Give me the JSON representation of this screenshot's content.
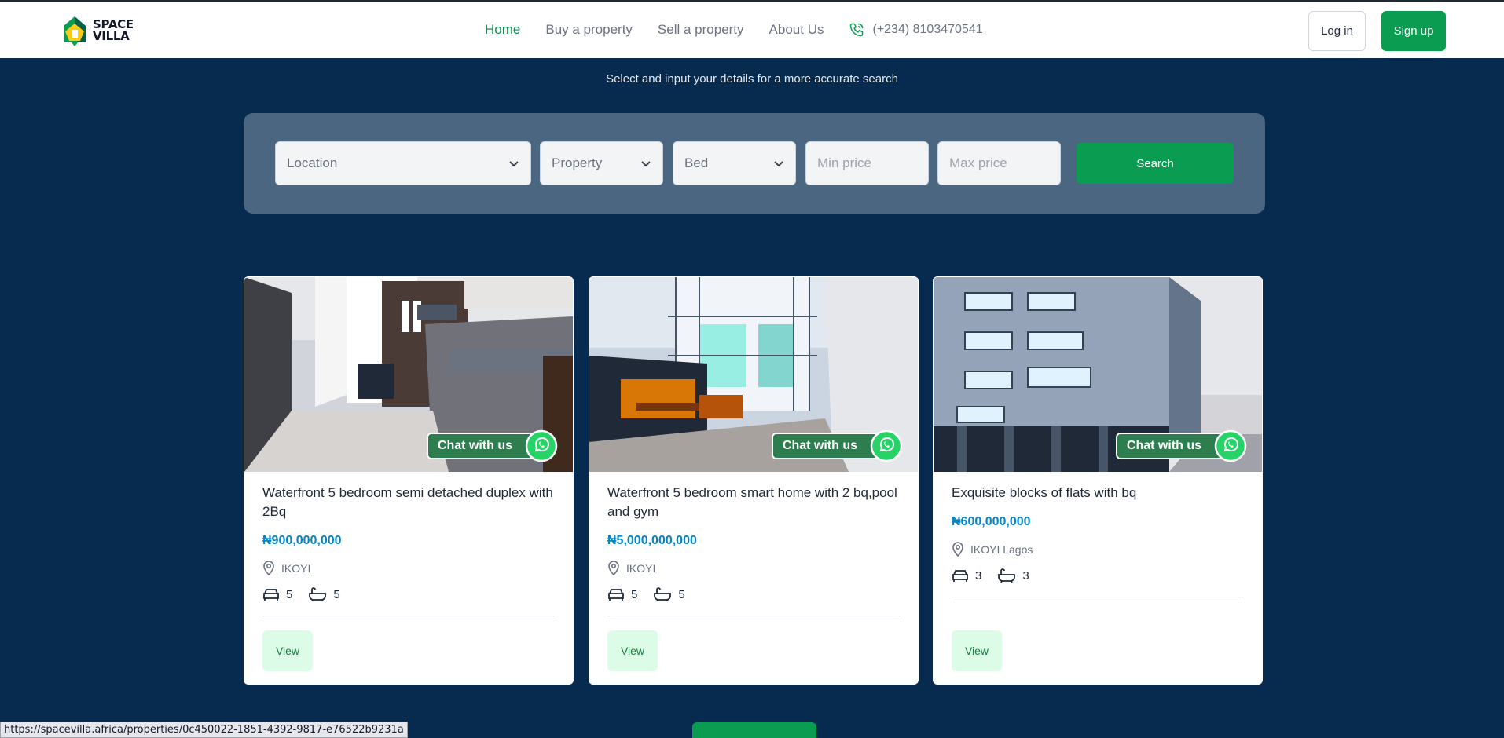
{
  "brand": {
    "line1": "SPACE",
    "line2": "VILLA"
  },
  "nav": {
    "items": [
      {
        "label": "Home",
        "active": true
      },
      {
        "label": "Buy a property",
        "active": false
      },
      {
        "label": "Sell a property",
        "active": false
      },
      {
        "label": "About Us",
        "active": false
      }
    ],
    "phone": "(+234) 8103470541",
    "login_label": "Log in",
    "signup_label": "Sign up"
  },
  "hero": {
    "subtitle": "Select and input your details for a more accurate search"
  },
  "search": {
    "location": "Location",
    "property": "Property",
    "bed": "Bed",
    "min_price_placeholder": "Min price",
    "max_price_placeholder": "Max price",
    "button": "Search"
  },
  "cards": [
    {
      "title": "Waterfront 5 bedroom semi detached duplex with 2Bq",
      "price": "₦900,000,000",
      "location": "IKOYI",
      "beds": "5",
      "baths": "5",
      "chat": "Chat with us",
      "view": "View"
    },
    {
      "title": "Waterfront 5 bedroom smart home with 2 bq,pool and gym",
      "price": "₦5,000,000,000",
      "location": "IKOYI",
      "beds": "5",
      "baths": "5",
      "chat": "Chat with us",
      "view": "View"
    },
    {
      "title": "Exquisite blocks of flats with bq",
      "price": "₦600,000,000",
      "location": "IKOYI Lagos",
      "beds": "3",
      "baths": "3",
      "chat": "Chat with us",
      "view": "View"
    }
  ],
  "status_url": "https://spacevilla.africa/properties/0c450022-1851-4392-9817-e76522b9231a",
  "colors": {
    "accent": "#0a9c51",
    "background": "#062b4f",
    "price": "#0284c7"
  }
}
